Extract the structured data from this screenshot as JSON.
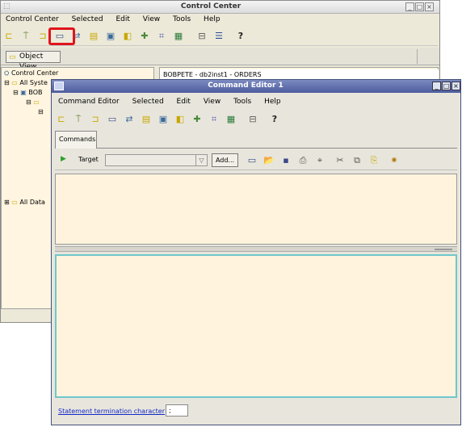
{
  "control_center": {
    "title": "Control Center",
    "menu": [
      "Control Center",
      "Selected",
      "Edit",
      "View",
      "Tools",
      "Help"
    ],
    "object_view_button": "Object View",
    "tree": [
      "Control Center",
      "All Syste",
      "BOB",
      "All Data"
    ],
    "right_header": "BOBPETE - db2inst1 - ORDERS"
  },
  "command_editor": {
    "title": "Command Editor 1",
    "menu": [
      "Command Editor",
      "Selected",
      "Edit",
      "View",
      "Tools",
      "Help"
    ],
    "tab": "Commands",
    "target_label": "Target",
    "target_value": "",
    "add_button": "Add...",
    "termination_label": "Statement termination character",
    "termination_value": ";"
  },
  "icons": {
    "cc_toolbar": [
      "object-tree-icon",
      "satellite-icon",
      "replication-icon",
      "command-editor-icon",
      "task-center-icon",
      "journal-icon",
      "license-icon",
      "tools-settings-icon",
      "health-icon",
      "memory-icon",
      "wizard-icon",
      "show-help-icon",
      "help-icon"
    ],
    "ce_toolbar": [
      "object-tree-icon",
      "satellite-icon",
      "replication-icon",
      "command-editor-icon",
      "task-center-icon",
      "journal-icon",
      "license-icon",
      "tools-settings-icon",
      "health-icon",
      "memory-icon",
      "wizard-icon",
      "help-icon"
    ],
    "cmd_toolbar": [
      "execute-icon",
      "open-icon",
      "save-icon",
      "print-icon",
      "find-icon",
      "cut-icon",
      "copy-icon",
      "paste-icon",
      "clear-icon"
    ]
  },
  "colors": {
    "highlight": "#e0141c",
    "ce_title_bar": "#5a68a8",
    "pane_bg": "#fff3dd"
  }
}
